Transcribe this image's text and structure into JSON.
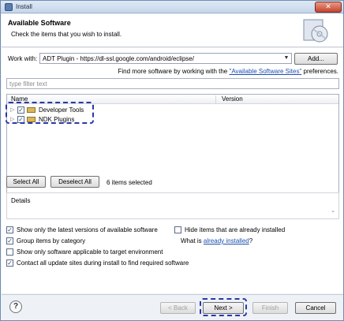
{
  "window": {
    "title": "Install",
    "close_glyph": "✕"
  },
  "header": {
    "title": "Available Software",
    "subtitle": "Check the items that you wish to install.",
    "art_icon": "install-cd-icon"
  },
  "work_with": {
    "label": "Work with:",
    "value": "ADT Plugin - https://dl-ssl.google.com/android/eclipse/",
    "add_label": "Add..."
  },
  "find_more": {
    "text": "Find more software by working with the",
    "link": "\"Available Software Sites\"",
    "suffix": "preferences."
  },
  "filter": {
    "placeholder": "type filter text"
  },
  "table": {
    "columns": [
      "Name",
      "Version"
    ],
    "rows": [
      {
        "label": "Developer Tools",
        "checked": true
      },
      {
        "label": "NDK Plugins",
        "checked": true
      }
    ]
  },
  "selection": {
    "select_all": "Select All",
    "deselect_all": "Deselect All",
    "count_text": "6 items selected"
  },
  "details": {
    "label": "Details"
  },
  "options": {
    "latest": {
      "label": "Show only the latest versions of available software",
      "checked": true
    },
    "hide": {
      "label": "Hide items that are already installed",
      "checked": false
    },
    "group": {
      "label": "Group items by category",
      "checked": true
    },
    "what_is": {
      "text": "What is",
      "link": "already installed",
      "suffix": "?"
    },
    "applicable": {
      "label": "Show only software applicable to target environment",
      "checked": false
    },
    "contact": {
      "label": "Contact all update sites during install to find required software",
      "checked": true
    }
  },
  "footer": {
    "help": "?",
    "back": "< Back",
    "next": "Next >",
    "finish": "Finish",
    "cancel": "Cancel"
  }
}
